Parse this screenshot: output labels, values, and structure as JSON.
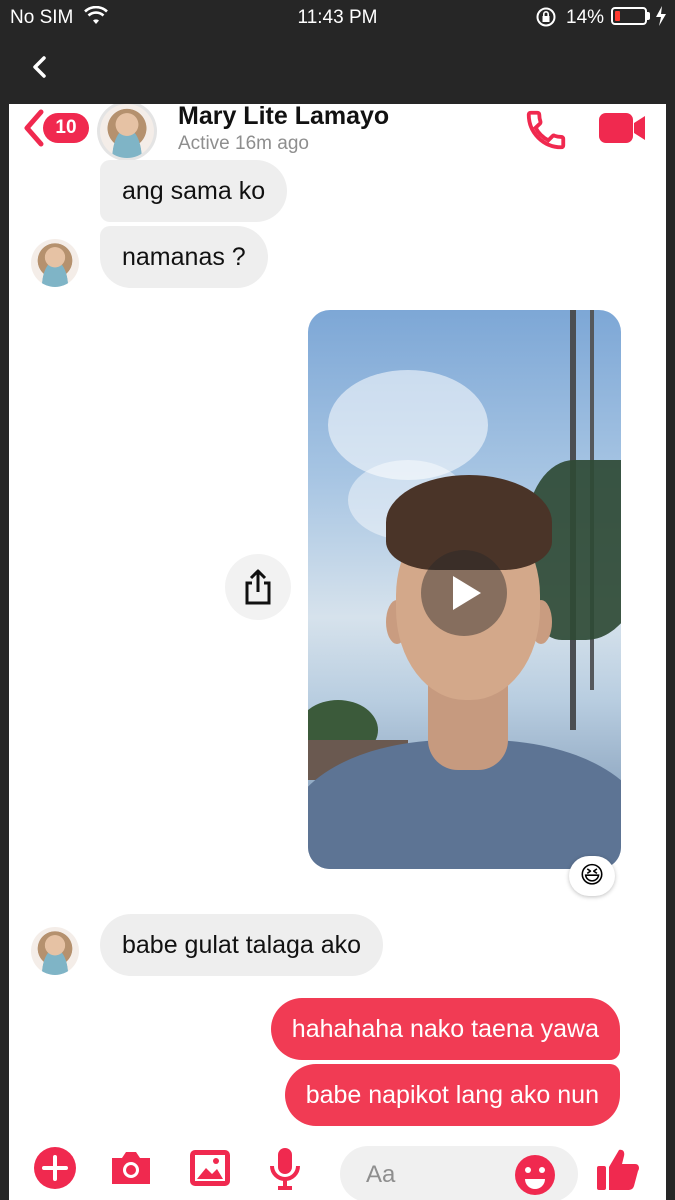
{
  "status_bar": {
    "carrier": "No SIM",
    "time": "11:43 PM",
    "battery_percent": "14%"
  },
  "header": {
    "unread_count": "10",
    "contact_name": "Mary Lite Lamayo",
    "contact_status": "Active 16m ago"
  },
  "messages": {
    "m1": "ang sama ko",
    "m2": "namanas ?",
    "m3": "babe gulat talaga ako",
    "m4": "hahahaha nako taena yawa",
    "m5": "babe napikot lang ako nun"
  },
  "video_reaction": "😆",
  "composer": {
    "placeholder": "Aa"
  },
  "colors": {
    "accent": "#f0294f",
    "outgoing_bubble": "#f13b54",
    "incoming_bubble": "#eeeeee",
    "status_bar_bg": "#262626"
  },
  "icons": [
    "back-chevron-icon",
    "phone-icon",
    "video-camera-icon",
    "share-icon",
    "play-icon",
    "plus-icon",
    "camera-icon",
    "image-icon",
    "microphone-icon",
    "emoji-icon",
    "thumbs-up-icon"
  ]
}
